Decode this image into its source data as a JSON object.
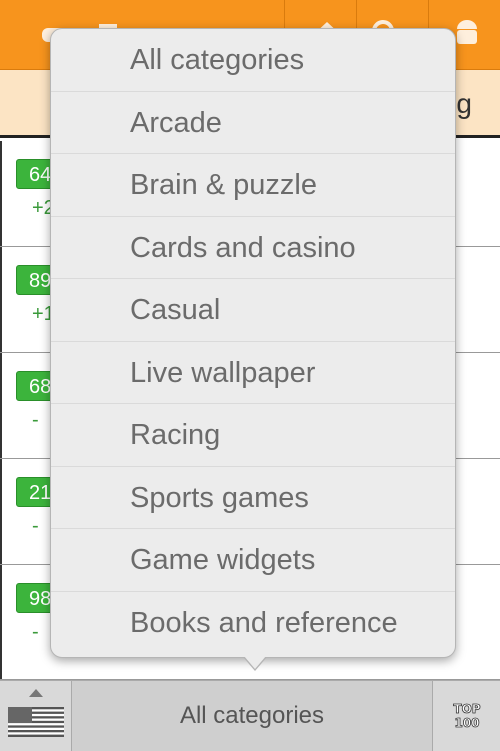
{
  "colors": {
    "toolbar": "#f7941d",
    "badge": "#3cb43c",
    "menu_bg": "#ececec"
  },
  "toolbar": {
    "icons": [
      "game-controller-icon",
      "home-icon",
      "search-icon",
      "android-icon"
    ]
  },
  "subheader": {
    "partial_text": "g"
  },
  "rows": [
    {
      "rank_partial": "64",
      "change_partial": "+2"
    },
    {
      "rank_partial": "89",
      "change_partial": "+1"
    },
    {
      "rank_partial": "68",
      "change_partial": "-"
    },
    {
      "rank_partial": "21",
      "change_partial": "-"
    },
    {
      "rank_partial": "98",
      "change_partial": "-"
    }
  ],
  "category_menu": {
    "items": [
      "All categories",
      "Arcade",
      "Brain & puzzle",
      "Cards and casino",
      "Casual",
      "Live wallpaper",
      "Racing",
      "Sports games",
      "Game widgets",
      "Books and reference"
    ]
  },
  "bottom_bar": {
    "selected_category": "All categories",
    "country_flag_icon": "us-flag-icon",
    "top100_icon": "top100-icon",
    "top100_text": [
      "TOP",
      "100"
    ]
  }
}
